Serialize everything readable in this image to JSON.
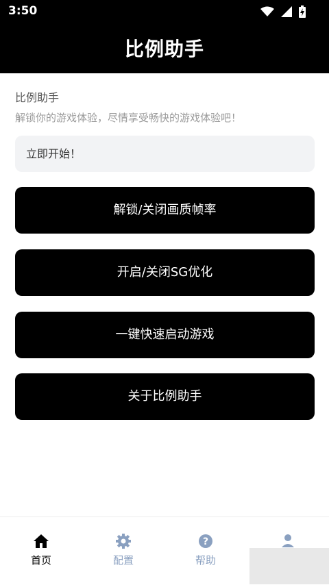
{
  "status_bar": {
    "time": "3:50"
  },
  "header": {
    "title": "比例助手"
  },
  "content": {
    "subtitle": "比例助手",
    "description": "解锁你的游戏体验，尽情享受畅快的游戏体验吧！",
    "start_box": "立即开始！",
    "buttons": [
      {
        "label": "解锁/关闭画质帧率"
      },
      {
        "label": "开启/关闭SG优化"
      },
      {
        "label": "一键快速启动游戏"
      },
      {
        "label": "关于比例助手"
      }
    ]
  },
  "bottom_nav": {
    "items": [
      {
        "label": "首页",
        "icon": "home-icon",
        "active": true
      },
      {
        "label": "配置",
        "icon": "gear-icon",
        "active": false
      },
      {
        "label": "帮助",
        "icon": "help-icon",
        "active": false
      },
      {
        "label": "",
        "icon": "user-icon",
        "active": false
      }
    ]
  },
  "colors": {
    "active": "#000000",
    "inactive": "#8aa0c0",
    "button_bg": "#000000"
  }
}
